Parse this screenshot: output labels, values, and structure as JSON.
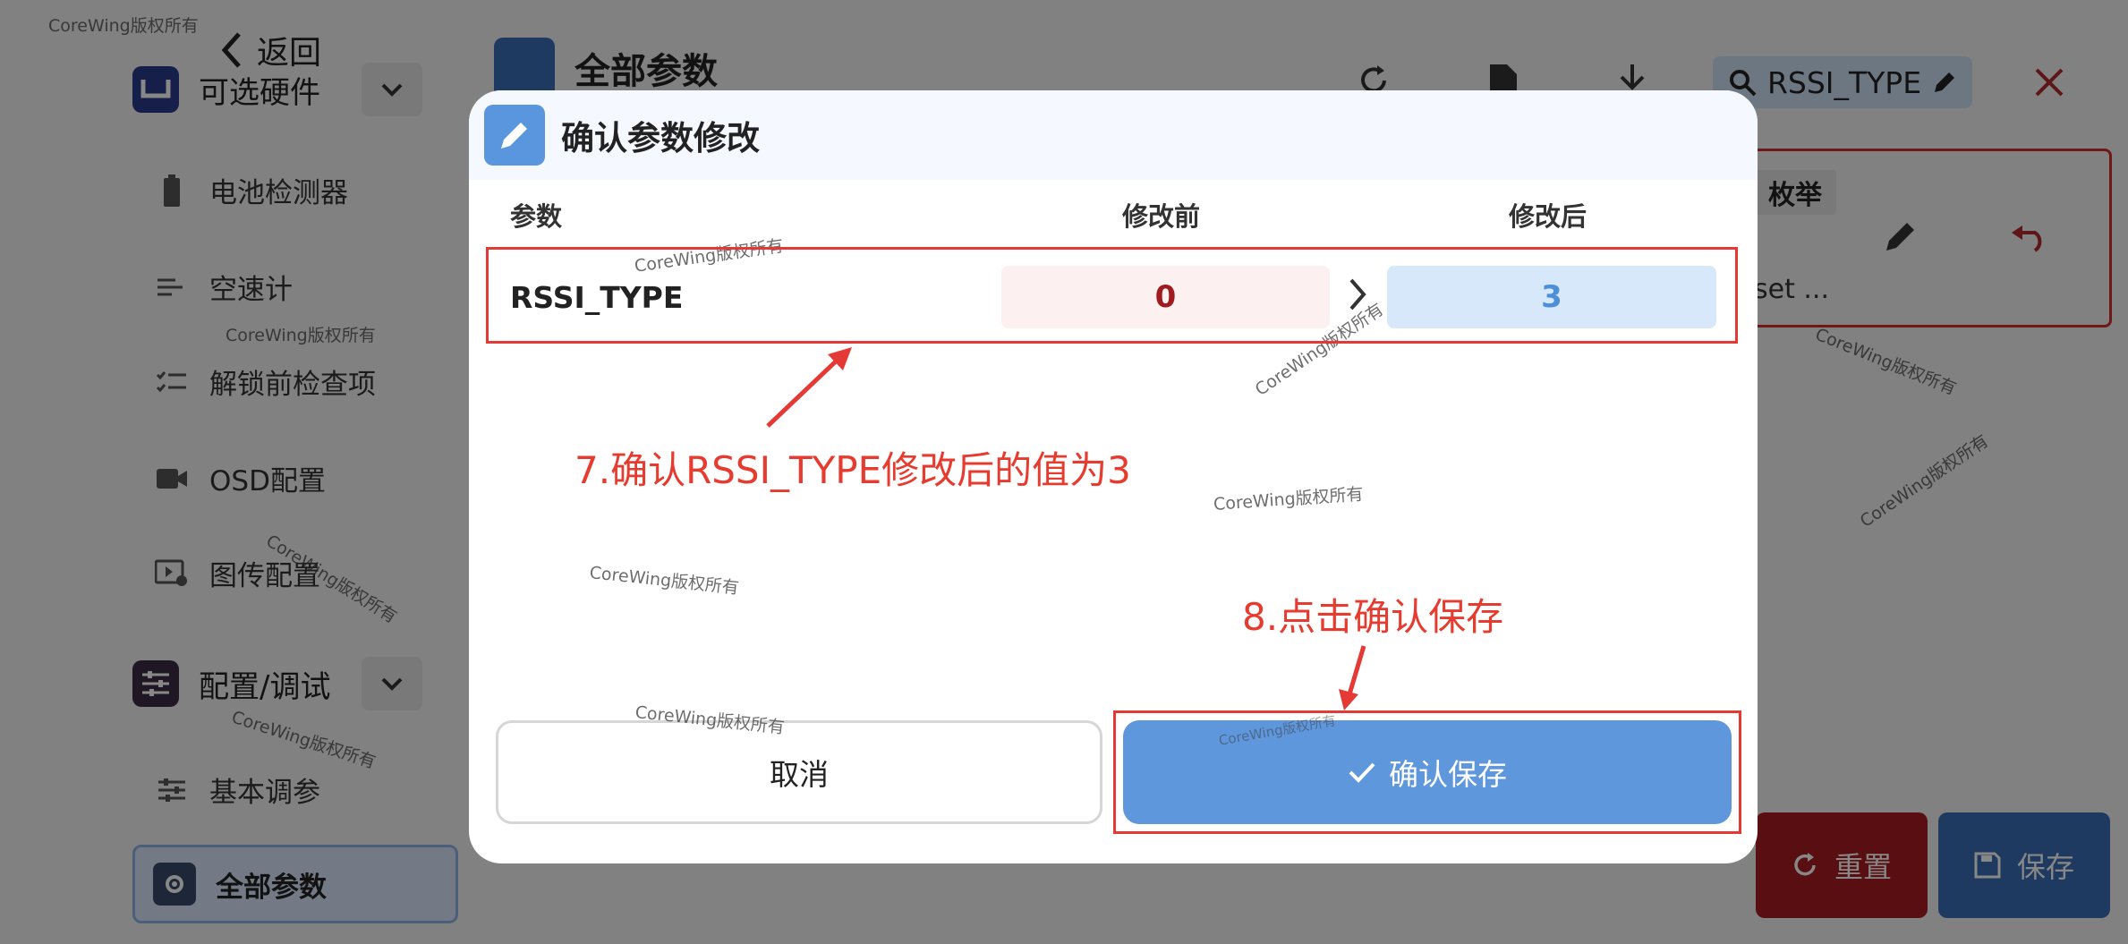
{
  "header": {
    "back_label": "返回",
    "page_title": "全部参数",
    "search_value": "RSSI_TYPE"
  },
  "sidebar": {
    "group_hardware": "可选硬件",
    "group_config": "配置/调试",
    "items": [
      {
        "label": "电池检测器",
        "icon": "battery-icon"
      },
      {
        "label": "空速计",
        "icon": "airspeed-icon"
      },
      {
        "label": "解锁前检查项",
        "icon": "checklist-icon"
      },
      {
        "label": "OSD配置",
        "icon": "camera-icon"
      },
      {
        "label": "图传配置",
        "icon": "video-settings-icon"
      },
      {
        "label": "基本调参",
        "icon": "sliders-icon"
      }
    ],
    "active_item": "全部参数"
  },
  "param_card": {
    "type_chip": "枚举",
    "desc_snippet": "set ..."
  },
  "actions": {
    "reset": "重置",
    "save": "保存"
  },
  "dialog": {
    "title": "确认参数修改",
    "col_param": "参数",
    "col_before": "修改前",
    "col_after": "修改后",
    "row": {
      "name": "RSSI_TYPE",
      "before": "0",
      "after": "3"
    },
    "cancel": "取消",
    "confirm": "确认保存"
  },
  "annotations": {
    "step7": "7.确认RSSI_TYPE修改后的值为3",
    "step8": "8.点击确认保存"
  },
  "watermark": "CoreWing版权所有",
  "colors": {
    "accent_blue": "#5f97dd",
    "danger_red": "#a81c22",
    "annotation_red": "#e53935"
  }
}
